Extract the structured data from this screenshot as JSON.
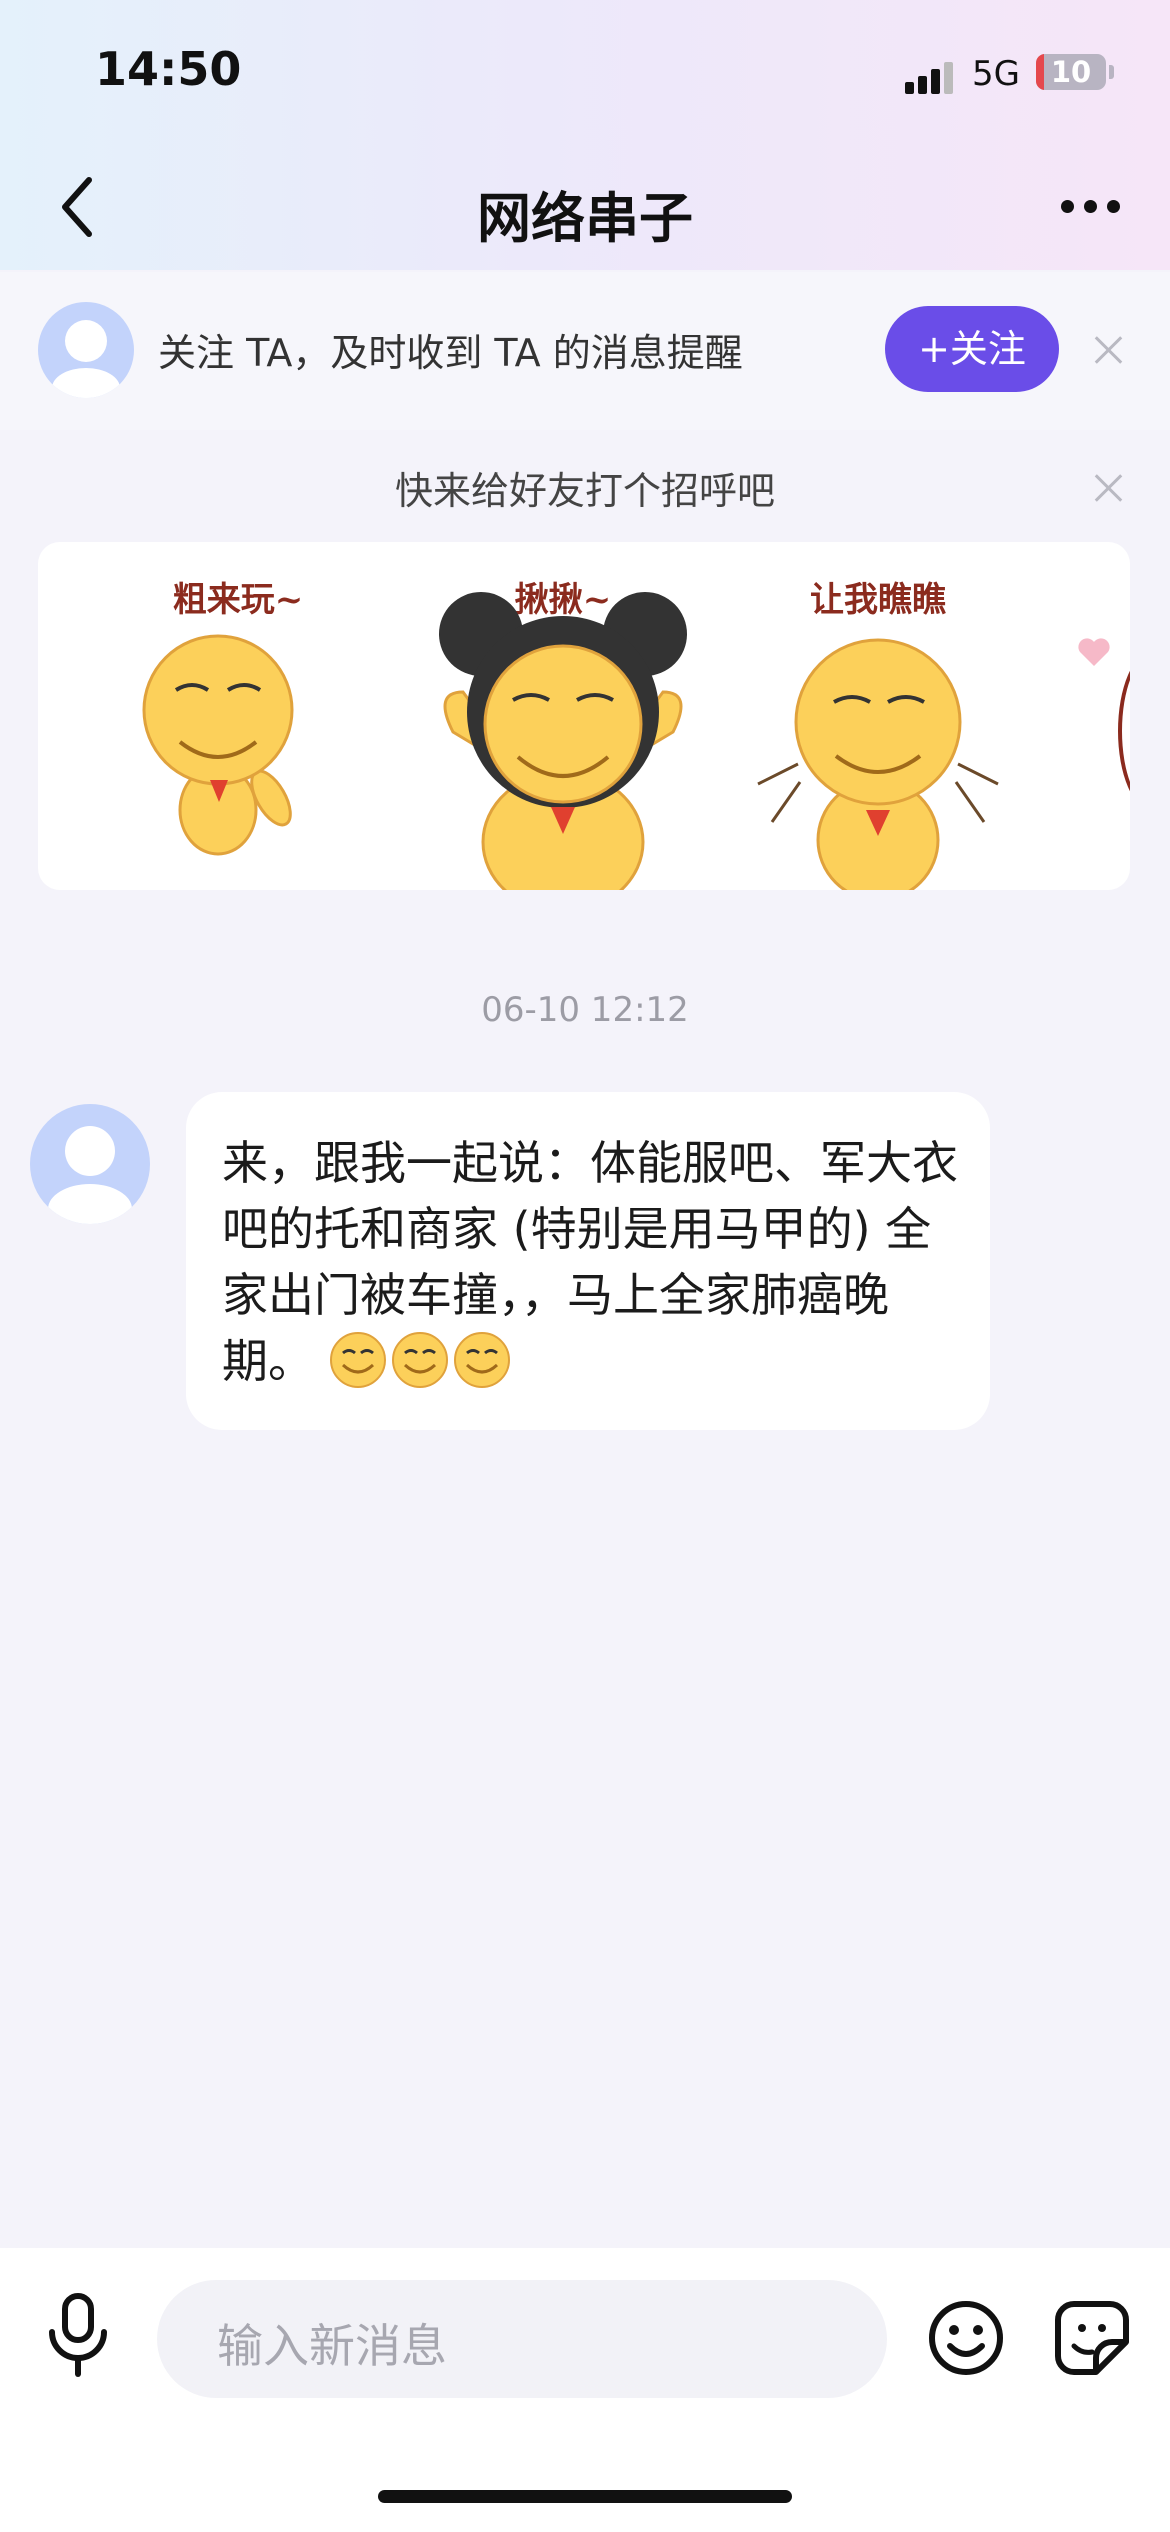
{
  "status_bar": {
    "time": "14:50",
    "network": "5G",
    "battery": "10",
    "battery_level": 0.1
  },
  "nav": {
    "title": "网络串子"
  },
  "follow_banner": {
    "text": "关注 TA，及时收到 TA 的消息提醒",
    "button_label": "+关注",
    "accent_color": "#6a4de8"
  },
  "greeting": {
    "text": "快来给好友打个招呼吧",
    "stickers": [
      {
        "caption": "粗来玩~",
        "icon": "smiley-sticker-waving"
      },
      {
        "caption": "揪揪~",
        "icon": "smiley-sticker-mouse-ears"
      },
      {
        "caption": "让我瞧瞧",
        "icon": "smiley-sticker-peeking"
      }
    ]
  },
  "messages": [
    {
      "timestamp": "06-10  12:12",
      "text": "来，跟我一起说：体能服吧、军大衣吧的托和商家 (特别是用马甲的) 全家出门被车撞，，马上全家肺癌晚期。",
      "emojis": [
        "grin-emoji",
        "grin-emoji",
        "grin-emoji"
      ]
    }
  ],
  "composer": {
    "placeholder": "输入新消息"
  }
}
